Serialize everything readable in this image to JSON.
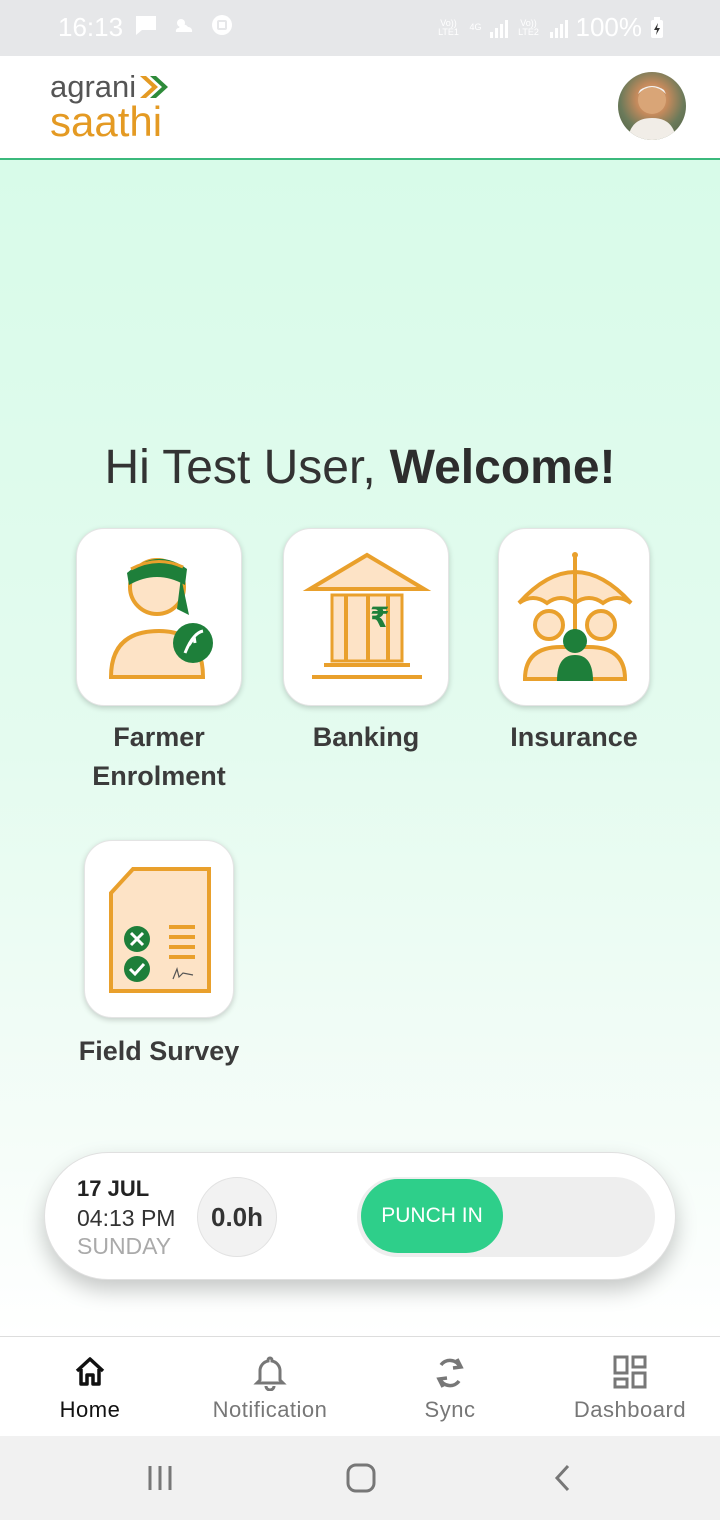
{
  "status_bar": {
    "time": "16:13",
    "network_left": "Vo)) LTE1",
    "network_4g": "4G",
    "network_right": "Vo)) LTE2",
    "battery": "100%"
  },
  "header": {
    "logo_top": "agrani",
    "logo_bottom": "saathi",
    "avatar_icon": "user-avatar"
  },
  "welcome": {
    "greeting": "Hi Test User,",
    "emphasis": "Welcome!"
  },
  "tiles": [
    {
      "label_line1": "Farmer",
      "label_line2": "Enrolment",
      "icon": "farmer-icon"
    },
    {
      "label_line1": "Banking",
      "icon": "bank-icon"
    },
    {
      "label_line1": "Insurance",
      "icon": "insurance-icon"
    },
    {
      "label_line1": "Field Survey",
      "icon": "survey-icon"
    }
  ],
  "punch": {
    "date": "17 JUL",
    "time": "04:13 PM",
    "weekday": "SUNDAY",
    "hours": "0.0h",
    "button_label": "PUNCH IN"
  },
  "bottom_nav": [
    {
      "label": "Home",
      "icon": "home-icon",
      "active": true
    },
    {
      "label": "Notification",
      "icon": "bell-icon"
    },
    {
      "label": "Sync",
      "icon": "sync-icon"
    },
    {
      "label": "Dashboard",
      "icon": "dashboard-icon"
    }
  ],
  "colors": {
    "accent_green": "#2ecf8a",
    "brand_orange": "#e49a23",
    "icon_fill": "#fde3c6",
    "dark_green": "#1e7f3a"
  }
}
